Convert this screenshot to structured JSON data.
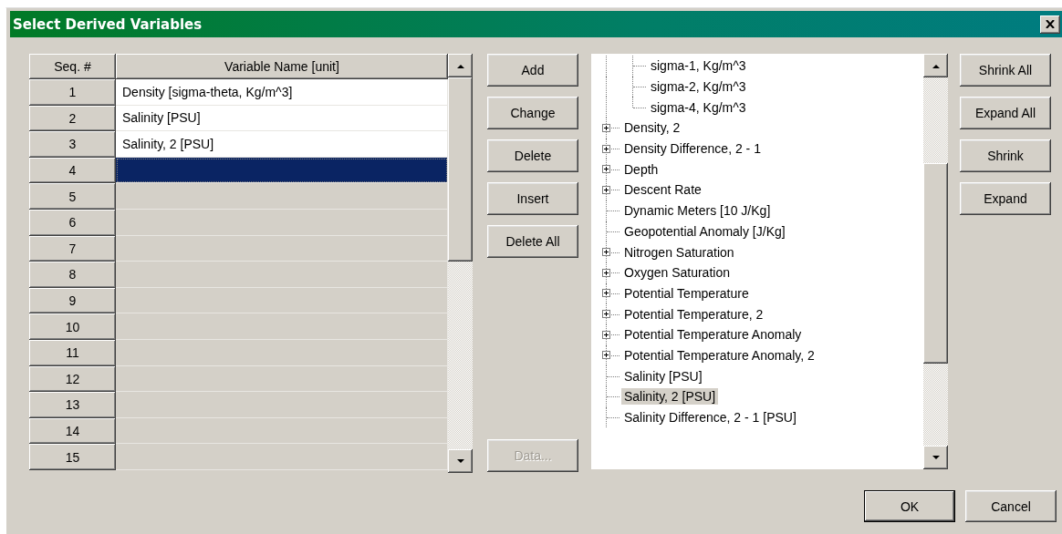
{
  "window": {
    "title": "Select Derived Variables"
  },
  "table": {
    "columns": [
      "Seq. #",
      "Variable Name [unit]"
    ],
    "rows": [
      {
        "seq": "1",
        "name": "Density [sigma-theta, Kg/m^3]",
        "selected": false
      },
      {
        "seq": "2",
        "name": "Salinity [PSU]",
        "selected": false
      },
      {
        "seq": "3",
        "name": "Salinity, 2 [PSU]",
        "selected": false
      },
      {
        "seq": "4",
        "selected": true
      },
      {
        "seq": "5",
        "selected": false
      },
      {
        "seq": "6",
        "selected": false
      },
      {
        "seq": "7",
        "selected": false
      },
      {
        "seq": "8",
        "selected": false
      },
      {
        "seq": "9",
        "selected": false
      },
      {
        "seq": "10",
        "selected": false
      },
      {
        "seq": "11",
        "selected": false
      },
      {
        "seq": "12",
        "selected": false
      },
      {
        "seq": "13",
        "selected": false
      },
      {
        "seq": "14",
        "selected": false
      },
      {
        "seq": "15",
        "selected": false
      }
    ]
  },
  "table_buttons": [
    {
      "label": "Add",
      "disabled": false
    },
    {
      "label": "Change",
      "disabled": false
    },
    {
      "label": "Delete",
      "disabled": false
    },
    {
      "label": "Insert",
      "disabled": false
    },
    {
      "label": "Delete All",
      "disabled": false
    },
    {
      "label": "Data...",
      "disabled": true
    }
  ],
  "tree": {
    "items": [
      {
        "kind": "node",
        "expanded": true,
        "children": [
          {
            "kind": "leaf",
            "label": "sigma-1, Kg/m^3",
            "selected": false
          },
          {
            "kind": "leaf",
            "label": "sigma-2, Kg/m^3",
            "selected": false
          },
          {
            "kind": "leaf",
            "label": "sigma-4, Kg/m^3",
            "selected": false
          }
        ]
      },
      {
        "kind": "node",
        "label": "Density, 2",
        "expanded": false,
        "selected": false
      },
      {
        "kind": "node",
        "label": "Density Difference, 2 - 1",
        "expanded": false,
        "selected": false
      },
      {
        "kind": "node",
        "label": "Depth",
        "expanded": false,
        "selected": false
      },
      {
        "kind": "node",
        "label": "Descent Rate",
        "expanded": false,
        "selected": false
      },
      {
        "kind": "leaf",
        "label": "Dynamic Meters [10 J/Kg]",
        "selected": false
      },
      {
        "kind": "leaf",
        "label": "Geopotential Anomaly [J/Kg]",
        "selected": false
      },
      {
        "kind": "node",
        "label": "Nitrogen Saturation",
        "expanded": false,
        "selected": false
      },
      {
        "kind": "node",
        "label": "Oxygen Saturation",
        "expanded": false,
        "selected": false
      },
      {
        "kind": "node",
        "label": "Potential Temperature",
        "expanded": false,
        "selected": false
      },
      {
        "kind": "node",
        "label": "Potential Temperature, 2",
        "expanded": false,
        "selected": false
      },
      {
        "kind": "node",
        "label": "Potential Temperature Anomaly",
        "expanded": false,
        "selected": false
      },
      {
        "kind": "node",
        "label": "Potential Temperature Anomaly, 2",
        "expanded": false,
        "selected": false
      },
      {
        "kind": "leaf",
        "label": "Salinity [PSU]",
        "selected": false
      },
      {
        "kind": "leaf",
        "label": "Salinity, 2 [PSU]",
        "selected": true
      },
      {
        "kind": "leaf",
        "label": "Salinity Difference, 2 - 1 [PSU]",
        "selected": false
      }
    ]
  },
  "tree_buttons": [
    {
      "label": "Shrink All"
    },
    {
      "label": "Expand All"
    },
    {
      "label": "Shrink"
    },
    {
      "label": "Expand"
    }
  ],
  "dialog_buttons": [
    {
      "label": "OK",
      "default": true
    },
    {
      "label": "Cancel",
      "default": false
    }
  ]
}
